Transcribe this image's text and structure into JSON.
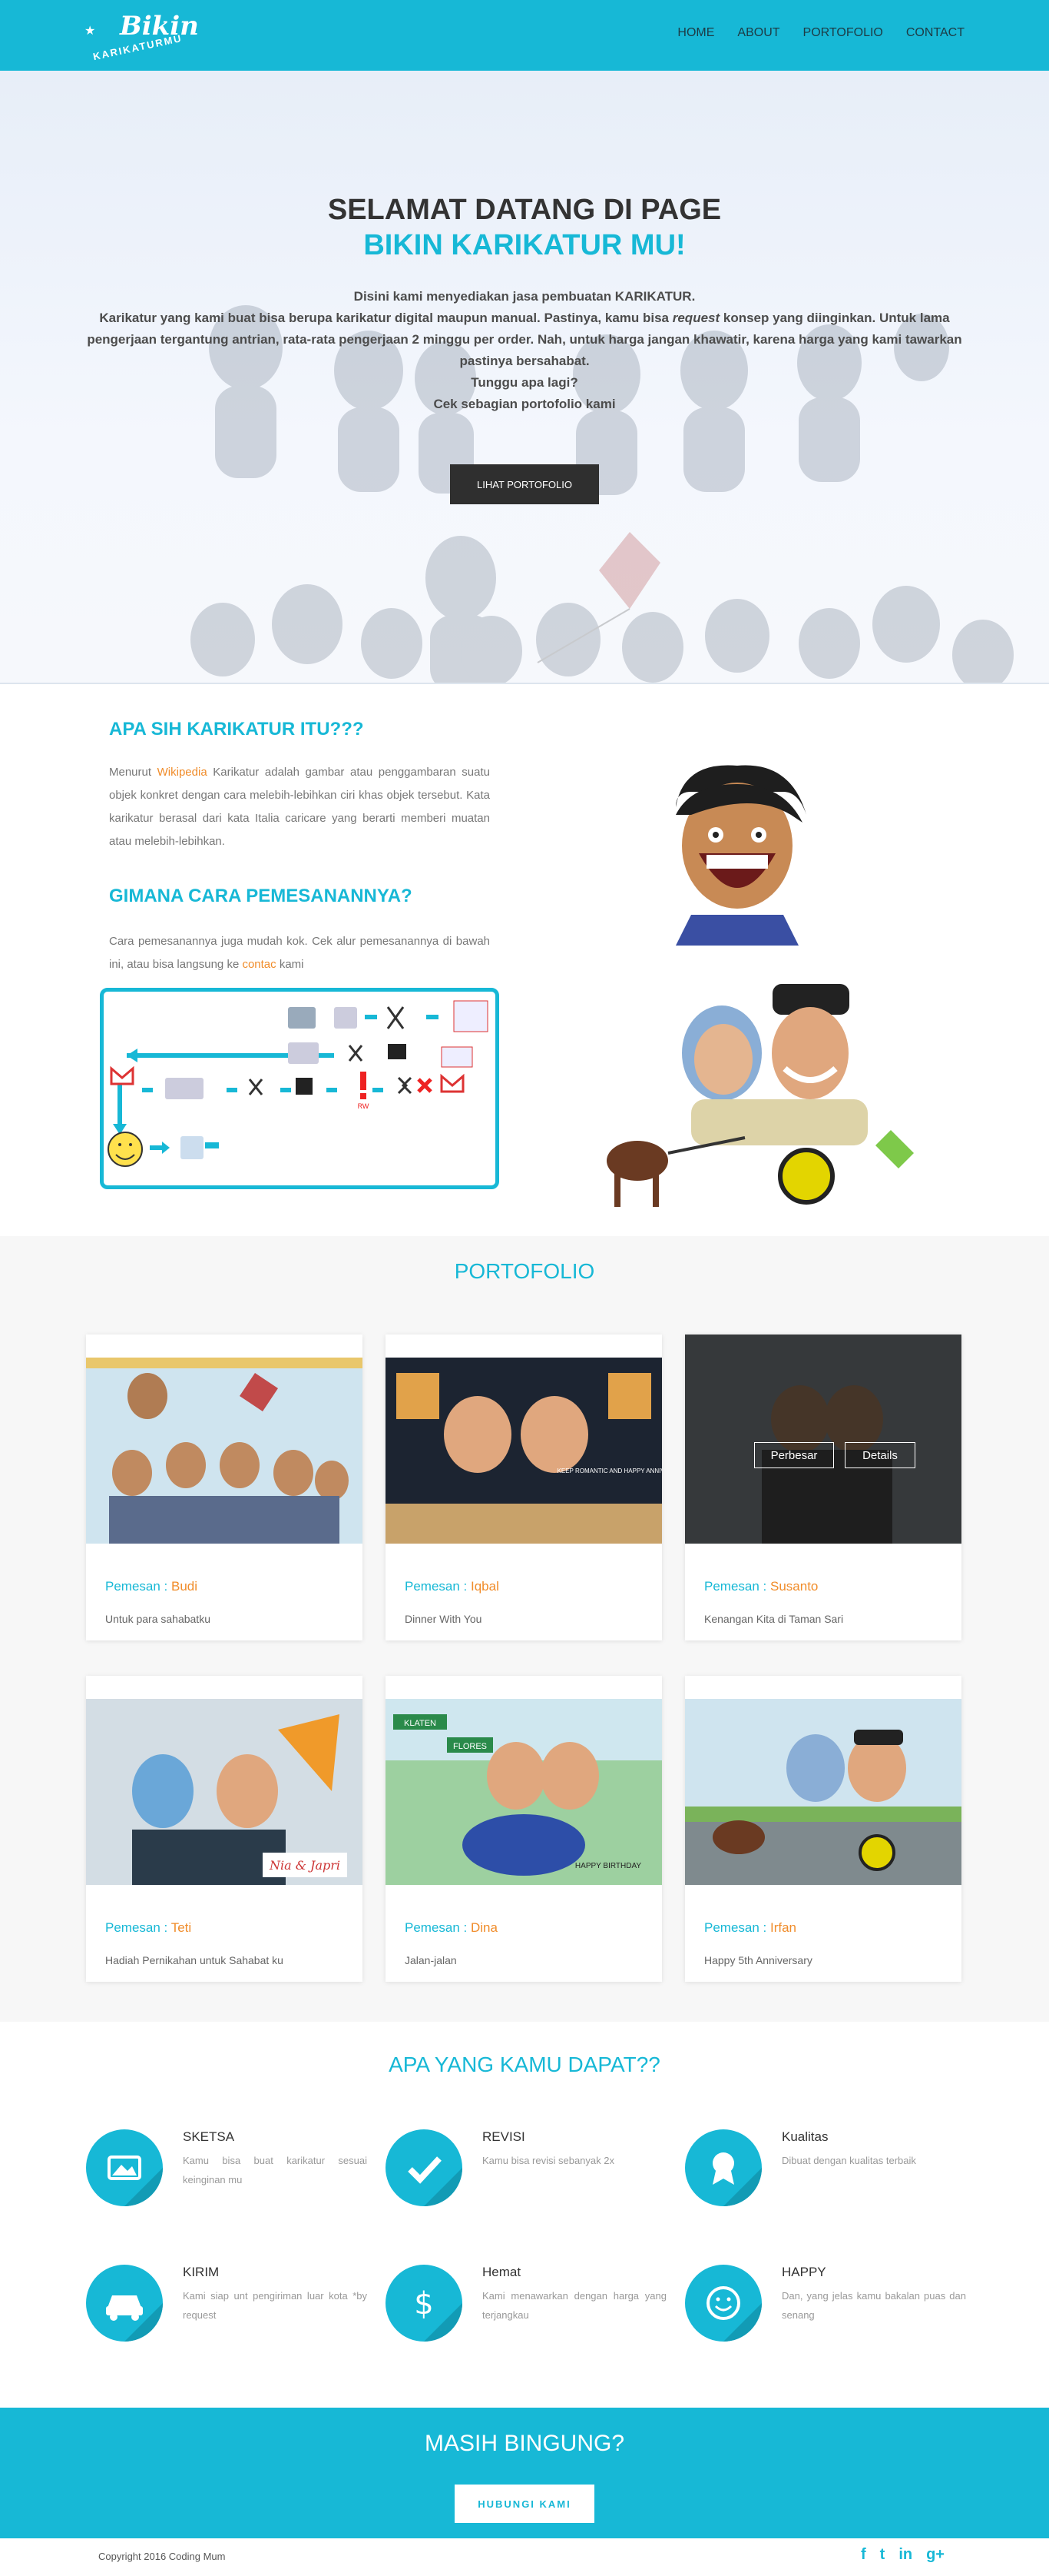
{
  "nav": {
    "logo_main": "Bikin",
    "logo_sub": "KARIKATURMU",
    "items": [
      "HOME",
      "ABOUT",
      "PORTOFOLIO",
      "CONTACT"
    ]
  },
  "hero": {
    "title1": "SELAMAT DATANG DI PAGE",
    "title2": "BIKIN KARIKATUR MU!",
    "line1": "Disini kami menyediakan jasa pembuatan KARIKATUR.",
    "line2a": "Karikatur yang kami buat bisa berupa karikatur digital maupun manual. Pastinya, kamu bisa ",
    "line2b": "request",
    "line2c": " konsep yang diinginkan. Untuk lama pengerjaan tergantung antrian, rata-rata pengerjaan 2 minggu per order. Nah, untuk harga jangan khawatir, karena harga yang kami tawarkan pastinya bersahabat.",
    "line3": "Tunggu apa lagi?",
    "line4": "Cek sebagian portofolio kami",
    "button": "LIHAT PORTOFOLIO"
  },
  "about": {
    "title1": "APA SIH KARIKATUR ITU???",
    "p1a": "Menurut ",
    "p1link": "Wikipedia",
    "p1b": " Karikatur adalah gambar atau penggambaran suatu objek konkret dengan cara melebih-lebihkan ciri khas objek tersebut. Kata karikatur berasal dari kata Italia caricare yang berarti memberi muatan atau melebih-lebihkan.",
    "title2": "GIMANA CARA PEMESANANNYA?",
    "p2a": "Cara pemesanannya juga mudah kok. Cek alur pemesanannya di bawah ini, atau bisa langsung ke ",
    "p2link": "contac",
    "p2b": " kami",
    "flow_badge": "RW"
  },
  "portfolio": {
    "title": "PORTOFOLIO",
    "label": "Pemesan : ",
    "overlay": {
      "enlarge": "Perbesar",
      "details": "Details"
    },
    "items": [
      {
        "name": "Budi",
        "desc": "Untuk para sahabatku"
      },
      {
        "name": "Iqbal",
        "desc": "Dinner With You",
        "art": "KEEP ROMANTIC AND HAPPY ANNIVERSARY"
      },
      {
        "name": "Susanto",
        "desc": "Kenangan Kita di Taman Sari"
      },
      {
        "name": "Teti",
        "desc": "Hadiah Pernikahan untuk Sahabat ku",
        "art": "Nia & Japri"
      },
      {
        "name": "Dina",
        "desc": "Jalan-jalan",
        "art": "HAPPY BIRTHDAY",
        "sign1": "KLATEN",
        "sign2": "FLORES"
      },
      {
        "name": "Irfan",
        "desc": "Happy 5th Anniversary"
      }
    ]
  },
  "benefits": {
    "title": "APA YANG KAMU DAPAT??",
    "items": [
      {
        "title": "SKETSA",
        "desc": "Kamu bisa buat karikatur sesuai keinginan mu",
        "icon": "image-icon"
      },
      {
        "title": "REVISI",
        "desc": "Kamu bisa revisi sebanyak 2x",
        "icon": "check-icon"
      },
      {
        "title": "Kualitas",
        "desc": "Dibuat dengan kualitas terbaik",
        "icon": "award-icon"
      },
      {
        "title": "KIRIM",
        "desc": "Kami siap unt pengiriman luar kota *by request",
        "icon": "car-icon"
      },
      {
        "title": "Hemat",
        "desc": "Kami menawarkan dengan harga yang terjangkau",
        "icon": "dollar-icon"
      },
      {
        "title": "HAPPY",
        "desc": "Dan, yang jelas kamu bakalan puas dan senang",
        "icon": "smile-icon"
      }
    ]
  },
  "cta": {
    "title": "MASIH BINGUNG?",
    "button": "HUBUNGI KAMI"
  },
  "footer": {
    "copyright": "Copyright  2016   Coding Mum",
    "social": [
      "f",
      "t",
      "in",
      "g+"
    ]
  },
  "colors": {
    "accent": "#17b8d6",
    "orange": "#f08c2a",
    "dark": "#2f2f2f"
  }
}
